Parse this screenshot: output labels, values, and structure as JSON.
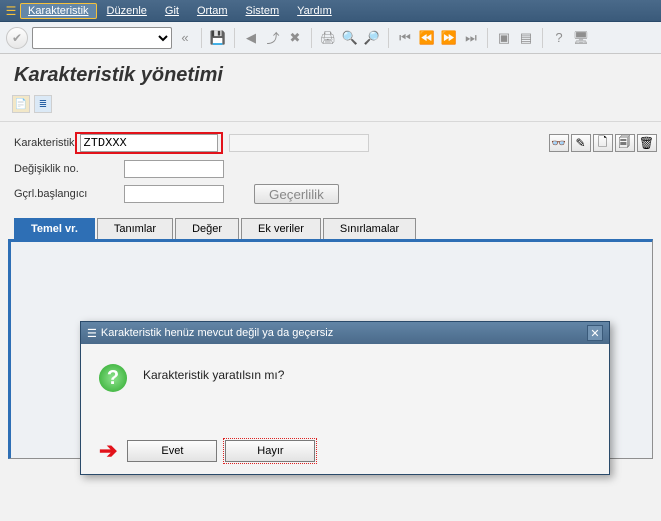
{
  "menubar": {
    "items": [
      "Karakteristik",
      "Düzenle",
      "Git",
      "Ortam",
      "Sistem",
      "Yardım"
    ]
  },
  "page": {
    "title": "Karakteristik yönetimi"
  },
  "form": {
    "char_label": "Karakteristik",
    "char_value": "ZTDXXX",
    "change_label": "Değişiklik no.",
    "change_value": "",
    "valid_label": "Gçrl.başlangıcı",
    "valid_value": "",
    "validity_btn": "Geçerlilik"
  },
  "action_icons": {
    "display": "display-characteristic-icon",
    "change": "change-characteristic-icon",
    "create": "create-characteristic-icon",
    "copy": "copy-characteristic-icon",
    "delete": "delete-characteristic-icon"
  },
  "tabs": [
    "Temel vr.",
    "Tanımlar",
    "Değer",
    "Ek veriler",
    "Sınırlamalar"
  ],
  "dialog": {
    "title": "Karakteristik henüz mevcut değil ya da geçersiz",
    "message": "Karakteristik yaratılsın mı?",
    "yes": "Evet",
    "no": "Hayır"
  }
}
